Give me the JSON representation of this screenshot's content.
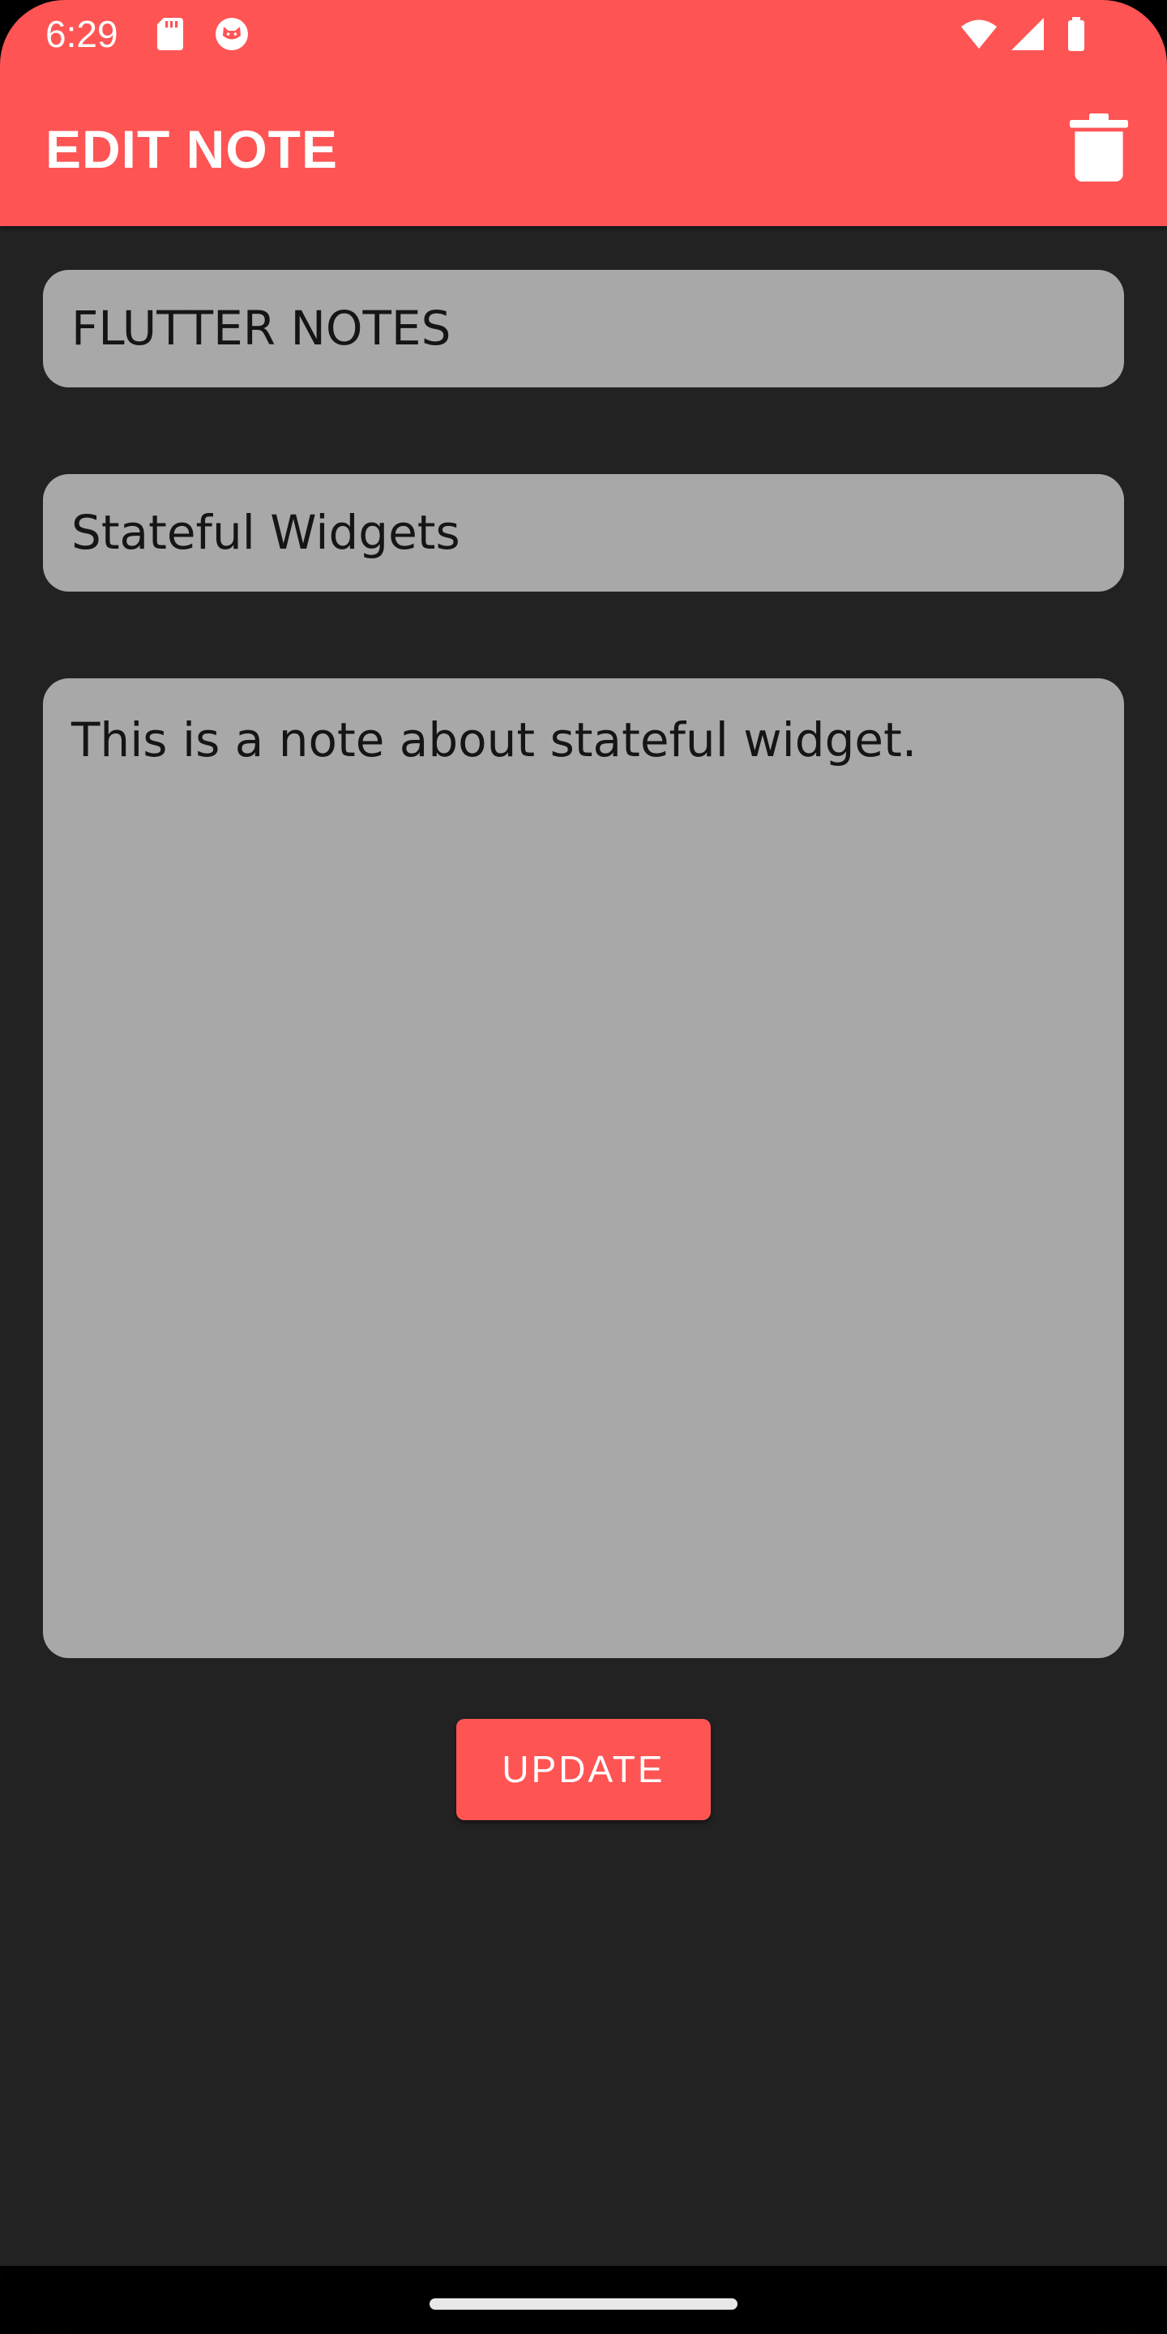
{
  "status_bar": {
    "time": "6:29",
    "left_icons": [
      "sd-card-icon",
      "cat-face-icon"
    ],
    "right_icons": [
      "wifi-icon",
      "signal-icon",
      "battery-icon"
    ]
  },
  "app_bar": {
    "title": "EDIT NOTE",
    "action_icon": "trash-icon",
    "color": "#FF5454"
  },
  "form": {
    "title_value": "FLUTTER NOTES",
    "subtitle_value": "Stateful Widgets",
    "body_value": "This is a note about stateful widget.",
    "field_color": "#A8A8A8"
  },
  "actions": {
    "update_label": "UPDATE"
  },
  "theme": {
    "background": "#222222",
    "accent": "#FF5454"
  }
}
